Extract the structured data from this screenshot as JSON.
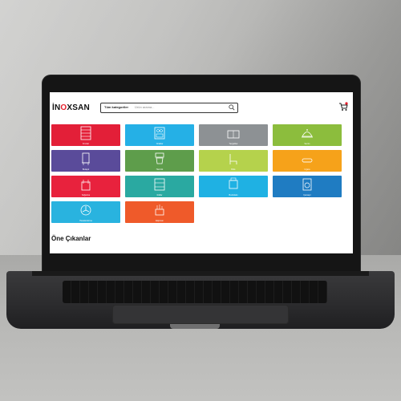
{
  "brand": {
    "logo_prefix": "İN",
    "logo_o": "O",
    "logo_suffix": "XSAN"
  },
  "search": {
    "category_label": "Tüm kategoriler",
    "placeholder": "Ürün arama..."
  },
  "featured_heading": "Öne Çıkanlar",
  "tiles": [
    {
      "label": "Fırınlar",
      "color": "#e31f38",
      "icon": "oven-icon"
    },
    {
      "label": "Ocaklar",
      "color": "#25b0e6",
      "icon": "cooker-icon"
    },
    {
      "label": "Tezgahlar",
      "color": "#8d9194",
      "icon": "counter-icon"
    },
    {
      "label": "Servis",
      "color": "#8cbd3d",
      "icon": "cloche-icon"
    },
    {
      "label": "Bulaşık",
      "color": "#5a4b9a",
      "icon": "dishwasher-icon"
    },
    {
      "label": "Hazırlık",
      "color": "#5e9d4b",
      "icon": "mixer-icon"
    },
    {
      "label": "Büfe",
      "color": "#b5d24c",
      "icon": "chair-icon"
    },
    {
      "label": "Izgara",
      "color": "#f6a21a",
      "icon": "grill-icon"
    },
    {
      "label": "Soğutma",
      "color": "#e8223d",
      "icon": "fryer-icon"
    },
    {
      "label": "Raflar",
      "color": "#2aa9a1",
      "icon": "shelf-icon"
    },
    {
      "label": "Buzdolabı",
      "color": "#1fb1e3",
      "icon": "fridge-icon"
    },
    {
      "label": "Çamaşır",
      "color": "#1f7cc2",
      "icon": "washer-icon"
    },
    {
      "label": "Havalandırma",
      "color": "#29b3df",
      "icon": "fan-icon"
    },
    {
      "label": "Ekipman",
      "color": "#ef5a2a",
      "icon": "equipment-icon"
    }
  ]
}
